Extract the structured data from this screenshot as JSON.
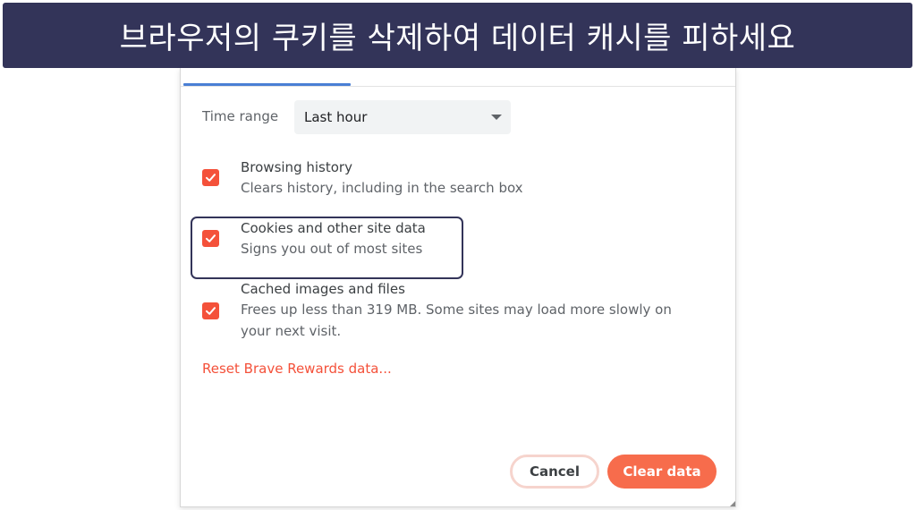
{
  "banner": {
    "title": "브라우저의 쿠키를 삭제하여 데이터 캐시를 피하세요"
  },
  "dialog": {
    "time_range": {
      "label": "Time range",
      "selected": "Last hour"
    },
    "items": [
      {
        "title": "Browsing history",
        "subtitle": "Clears history, including in the search box",
        "checked": true
      },
      {
        "title": "Cookies and other site data",
        "subtitle": "Signs you out of most sites",
        "checked": true
      },
      {
        "title": "Cached images and files",
        "subtitle_line1": "Frees up less than 319 MB. Some sites may load more slowly on",
        "subtitle_line2": "your next visit.",
        "checked": true
      }
    ],
    "reset_link": "Reset Brave Rewards data...",
    "buttons": {
      "cancel": "Cancel",
      "clear": "Clear data"
    }
  },
  "colors": {
    "accent": "#f4513a",
    "banner_bg": "#333459",
    "clear_button": "#f76c4c",
    "tab_indicator": "#4a7fd4"
  }
}
